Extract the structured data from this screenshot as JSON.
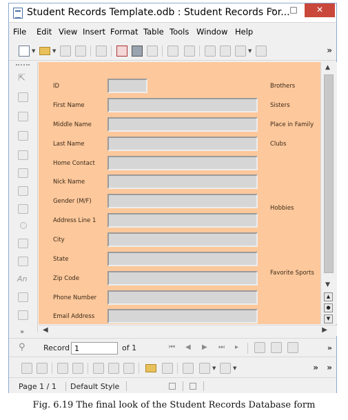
{
  "window": {
    "title": "Student Records Template.odb : Student Records For...",
    "controls": {
      "minimize": "−",
      "maximize": "□",
      "close": "✕"
    }
  },
  "menu": [
    {
      "label": "File"
    },
    {
      "label": "Edit"
    },
    {
      "label": "View"
    },
    {
      "label": "Insert"
    },
    {
      "label": "Format"
    },
    {
      "label": "Table"
    },
    {
      "label": "Tools"
    },
    {
      "label": "Window"
    },
    {
      "label": "Help"
    }
  ],
  "form": {
    "background": "#fdc89b",
    "fields": [
      {
        "label": "ID",
        "value": ""
      },
      {
        "label": "First Name",
        "value": ""
      },
      {
        "label": "Middle Name",
        "value": ""
      },
      {
        "label": "Last Name",
        "value": ""
      },
      {
        "label": "Home Contact",
        "value": ""
      },
      {
        "label": "Nick Name",
        "value": ""
      },
      {
        "label": "Gender (M/F)",
        "value": ""
      },
      {
        "label": "Address Line 1",
        "value": ""
      },
      {
        "label": "City",
        "value": ""
      },
      {
        "label": "State",
        "value": ""
      },
      {
        "label": "Zip Code",
        "value": ""
      },
      {
        "label": "Phone Number",
        "value": ""
      },
      {
        "label": "Email Address",
        "value": ""
      }
    ],
    "right_labels": [
      {
        "label": "Brothers"
      },
      {
        "label": "Sisters"
      },
      {
        "label": "Place in Family"
      },
      {
        "label": "Clubs"
      },
      {
        "label": "Hobbies"
      },
      {
        "label": "Favorite Sports"
      }
    ]
  },
  "navigation": {
    "record_label": "Record",
    "record_value": "1",
    "of_text": "of 1",
    "more": "»"
  },
  "statusbar": {
    "page": "Page 1 / 1",
    "style": "Default Style"
  },
  "caption": "Fig. 6.19 The final look of the Student Records Database form"
}
